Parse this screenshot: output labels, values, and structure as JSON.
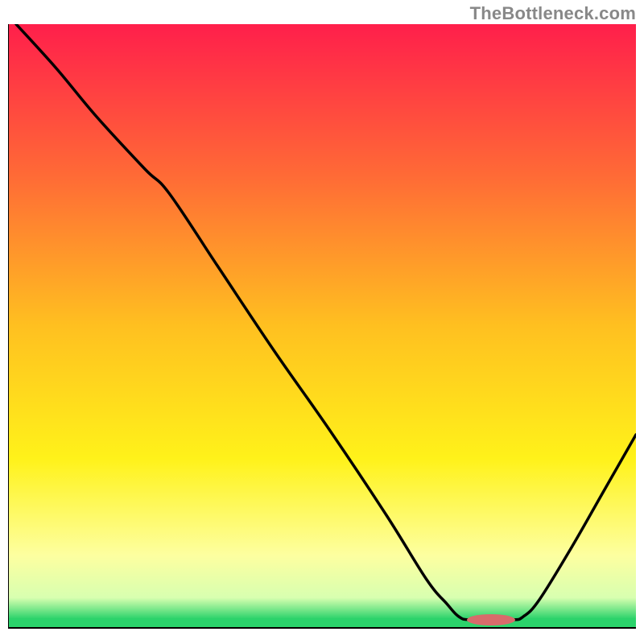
{
  "watermark": "TheBottleneck.com",
  "chart_data": {
    "type": "line",
    "title": "",
    "xlabel": "",
    "ylabel": "",
    "xlim": [
      0,
      780
    ],
    "ylim": [
      0,
      760
    ],
    "grid": false,
    "gradient": {
      "stops": [
        {
          "offset": 0.0,
          "color": "#ff1f4b"
        },
        {
          "offset": 0.25,
          "color": "#ff6a36"
        },
        {
          "offset": 0.5,
          "color": "#ffc020"
        },
        {
          "offset": 0.72,
          "color": "#fff21a"
        },
        {
          "offset": 0.88,
          "color": "#fdffa0"
        },
        {
          "offset": 0.95,
          "color": "#d8ffb0"
        },
        {
          "offset": 0.985,
          "color": "#2bd36b"
        },
        {
          "offset": 1.0,
          "color": "#2bd36b"
        }
      ]
    },
    "green_band": {
      "y": 738,
      "h": 12,
      "color": "#2bd36b"
    },
    "axis": {
      "color": "#000000",
      "width": 2
    },
    "curve": {
      "color": "#000000",
      "width": 3.5,
      "points": [
        {
          "x": 10,
          "y": 0
        },
        {
          "x": 60,
          "y": 55
        },
        {
          "x": 110,
          "y": 115
        },
        {
          "x": 170,
          "y": 180
        },
        {
          "x": 200,
          "y": 210
        },
        {
          "x": 260,
          "y": 300
        },
        {
          "x": 330,
          "y": 405
        },
        {
          "x": 400,
          "y": 505
        },
        {
          "x": 470,
          "y": 610
        },
        {
          "x": 520,
          "y": 690
        },
        {
          "x": 545,
          "y": 720
        },
        {
          "x": 560,
          "y": 736
        },
        {
          "x": 575,
          "y": 740
        },
        {
          "x": 625,
          "y": 740
        },
        {
          "x": 640,
          "y": 736
        },
        {
          "x": 660,
          "y": 715
        },
        {
          "x": 700,
          "y": 650
        },
        {
          "x": 740,
          "y": 580
        },
        {
          "x": 780,
          "y": 510
        }
      ]
    },
    "marker": {
      "x": 600,
      "y": 740,
      "rx": 30,
      "ry": 7,
      "color": "#d86b6b"
    }
  }
}
